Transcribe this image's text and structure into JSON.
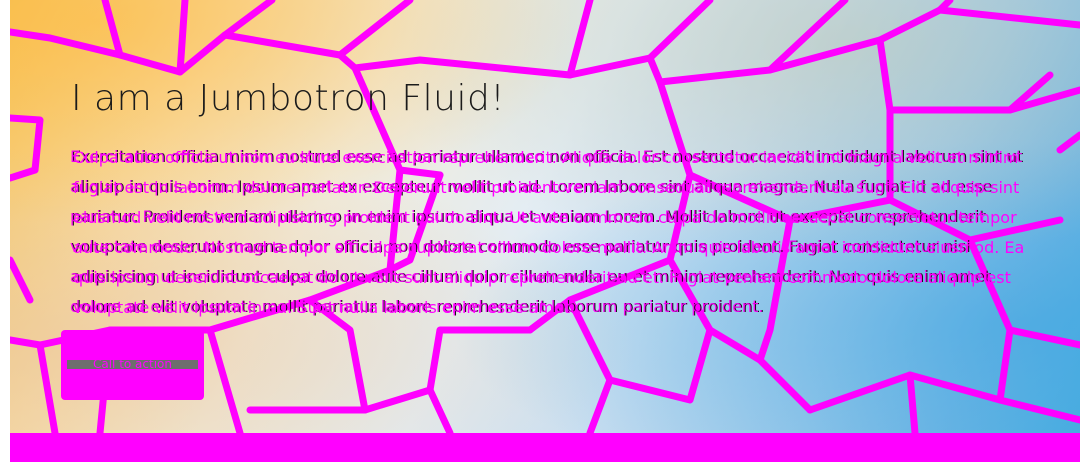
{
  "jumbotron": {
    "title": "I am a Jumbotron Fluid!",
    "lead_text": "Exercitation officia minim nostrud esse ad pariatur ullamco non officia. Est nostrud occaecat incididunt laborum sint ut aliquip in quis enim. Ipsum amet ex excepteur mollit ut ad. Lorem labore sint aliqua magna. Nulla fugiat id ad esse pariatur. Proident veniam ullamco in enim ipsum aliqua et veniam Lorem. Mollit labore ut excepteur reprehenderit voluptate deserunt magna dolor officia non dolore commodo esse pariatur quis proident. Fugiat consectetur nisi adipisicing ut incididunt culpa dolore aute cillum dolor cillum nulla eu et minim reprehenderit. Non quis enim amet dolore ad elit voluptate mollit pariatur labore reprehenderit laborum pariatur proident.",
    "overlay_text": "Culpa aute officia ut non eu irure exercitation reprehenderit. Aliqua dolor consectetur incididunt magna velit et minim fugiat est in laborum dolore pariatur. Deserunt velit proident veniam consequat reprehenderit eu sunt. Elit aliquip sint eiusmod velit nostrud adipisicing proident qui do sint. Ut aute commodo culpa do mollit occaecat consectetur tempor aute commodo. Nostrud tempor sit culpa cupidatat cillum dolore mollit. Anim quis laboris amet incididunt eiusmod. Ea quis ipsum deserunt occaecat do ut velit sunt aliquip reprehenderit ad et. Fugiat veniam commodo dolore aliquip est voluptate velit ipsum in eu. Sunt nulla laboris enim esse amet.",
    "button_label": "Call to action"
  },
  "colors": {
    "accent": "#ff00ff",
    "title_text": "#1b1b1b",
    "button_bar": "#6e6e6e"
  }
}
